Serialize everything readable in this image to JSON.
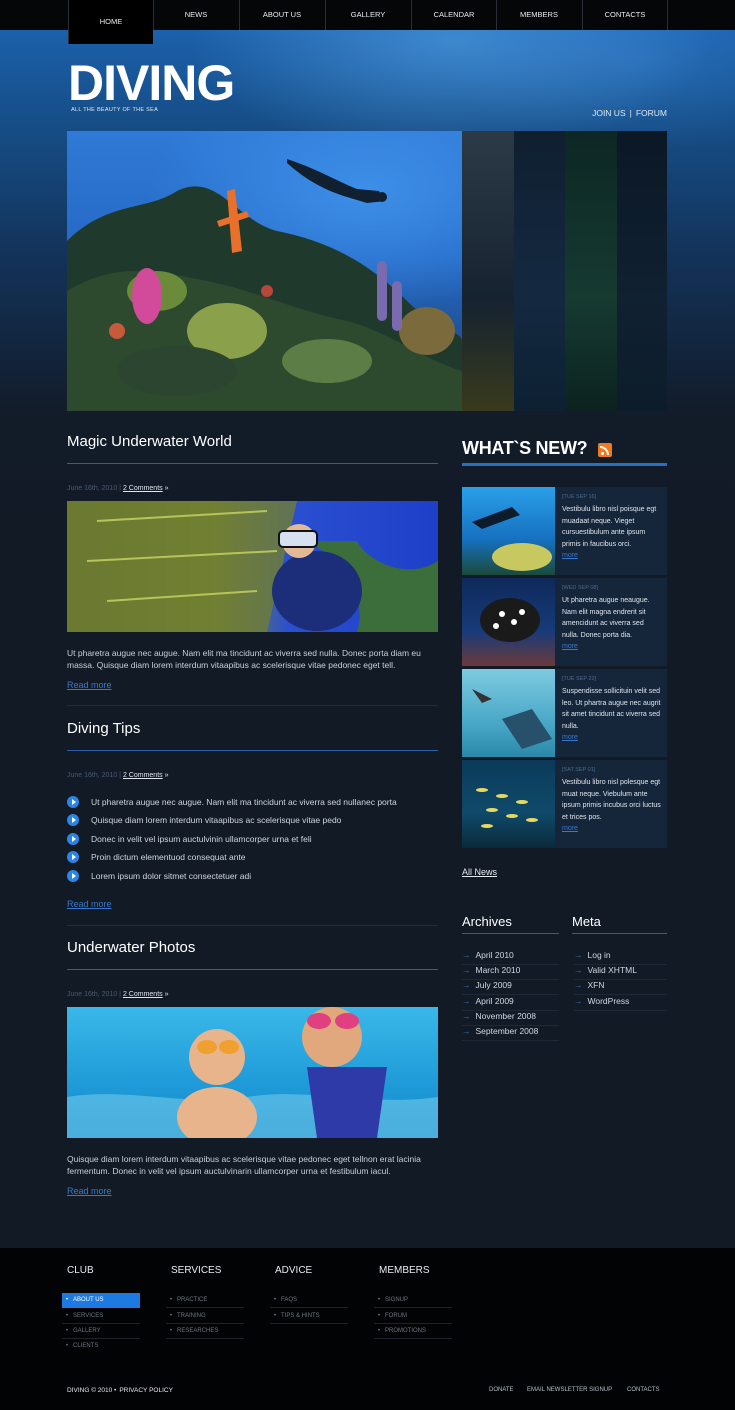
{
  "nav": {
    "items": [
      "HOME",
      "NEWS",
      "ABOUT US",
      "GALLERY",
      "CALENDAR",
      "MEMBERS",
      "CONTACTS"
    ],
    "active": "HOME"
  },
  "logo": {
    "title": "DIVING",
    "tagline": "ALL THE BEAUTY OF THE SEA"
  },
  "top_links": {
    "join": "JOIN US",
    "separator": "|",
    "forum": "FORUM"
  },
  "colors": {
    "accent": "#2a6ec2",
    "link": "#3b78c9",
    "rss": "#f07a1e",
    "footer_active": "#1d7ae0"
  },
  "posts": [
    {
      "title": "Magic Underwater World",
      "date": "June 16th, 2010",
      "sep": "|",
      "comments": "2 Comments",
      "arrow": "»",
      "text": "Ut pharetra augue nec augue. Nam elit ma tincidunt ac viverra sed nulla. Donec porta diam eu massa. Quisque diam lorem interdum vitaapibus ac scelerisque vitae pedonec eget tell.",
      "read_more": "Read more"
    },
    {
      "title": "Diving Tips",
      "date": "June 16th, 2010",
      "sep": "|",
      "comments": "2 Comments",
      "arrow": "»",
      "tips": [
        "Ut pharetra augue nec augue. Nam elit ma tincidunt ac viverra sed nullanec porta",
        "Quisque diam lorem interdum vitaapibus ac scelerisque vitae pedo",
        "Donec in velit vel ipsum auctulvinin ullamcorper urna et feli",
        "Proin dictum elementuod consequat ante",
        "Lorem ipsum dolor sitmet consectetuer adi"
      ],
      "read_more": "Read more"
    },
    {
      "title": "Underwater Photos",
      "date": "June 16th, 2010",
      "sep": "|",
      "comments": "2 Comments",
      "arrow": "»",
      "text": "Quisque diam lorem interdum vitaapibus ac scelerisque vitae pedonec eget tellnon erat lacinia fermentum. Donec in velit vel ipsum auctulvinarin ullamcorper urna et festibulum iacul.",
      "read_more": "Read more"
    }
  ],
  "whats_new": {
    "title": "WHAT`S NEW?",
    "icon": "rss-icon",
    "items": [
      {
        "date": "[TUE SEP 16]",
        "text": "Vestibulu libro nisl poisque egt muadaat neque. Vieget cursuestibulum ante ipsum primis in faucibus orci.",
        "more": "more"
      },
      {
        "date": "[WED SEP 08]",
        "text": "Ut pharetra augue neaugue. Nam elit magna endrerit sit amencidunt ac viverra sed nulla. Donec porta dia.",
        "more": "more"
      },
      {
        "date": "[TUE SEP 22]",
        "text": "Suspendisse sollicituin velit sed leo. Ut phartra augue nec augrit sit amet tincidunt ac viverra sed nulla.",
        "more": "more"
      },
      {
        "date": "[SAT SEP 01]",
        "text": "Vestibulu libro nisl polesque egt muat neque. Viebulum ante ipsum primis incubus orci luctus et trices pos.",
        "more": "more"
      }
    ],
    "all_news": "All News"
  },
  "archives": {
    "title": "Archives",
    "items": [
      "April 2010",
      "March 2010",
      "July 2009",
      "April 2009",
      "November 2008",
      "September 2008"
    ]
  },
  "meta": {
    "title": "Meta",
    "items": [
      "Log in",
      "Valid XHTML",
      "XFN",
      "WordPress"
    ]
  },
  "footer": {
    "columns": [
      {
        "title": "CLUB",
        "items": [
          "ABOUT US",
          "SERVICES",
          "GALLERY",
          "CLIENTS"
        ],
        "active": "ABOUT US"
      },
      {
        "title": "SERVICES",
        "items": [
          "PRACTICE",
          "TRAINING",
          "RESEARCHES"
        ]
      },
      {
        "title": "ADVICE",
        "items": [
          "FAQS",
          "TIPS & HINTS"
        ]
      },
      {
        "title": "MEMBERS",
        "items": [
          "SIGNUP",
          "FORUM",
          "PROMOTIONS"
        ]
      }
    ],
    "copyright": "DIVING © 2010 •",
    "privacy": "PRIVACY POLICY",
    "links": [
      "DONATE",
      "EMAIL NEWSLETTER SIGNUP",
      "CONTACTS"
    ]
  }
}
